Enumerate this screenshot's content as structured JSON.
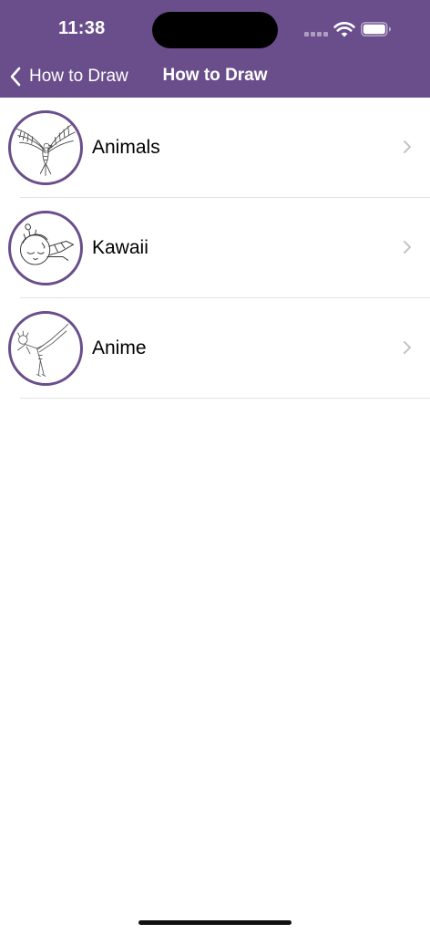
{
  "status_bar": {
    "time": "11:38"
  },
  "nav": {
    "back_label": "How to Draw",
    "title": "How to Draw"
  },
  "categories": [
    {
      "label": "Animals",
      "icon": "eagle-drawing"
    },
    {
      "label": "Kawaii",
      "icon": "kawaii-character-drawing"
    },
    {
      "label": "Anime",
      "icon": "anime-fighter-drawing"
    }
  ],
  "colors": {
    "accent": "#6a4e8c",
    "divider": "#e3e3e6",
    "chevron": "#c4c4c7"
  }
}
